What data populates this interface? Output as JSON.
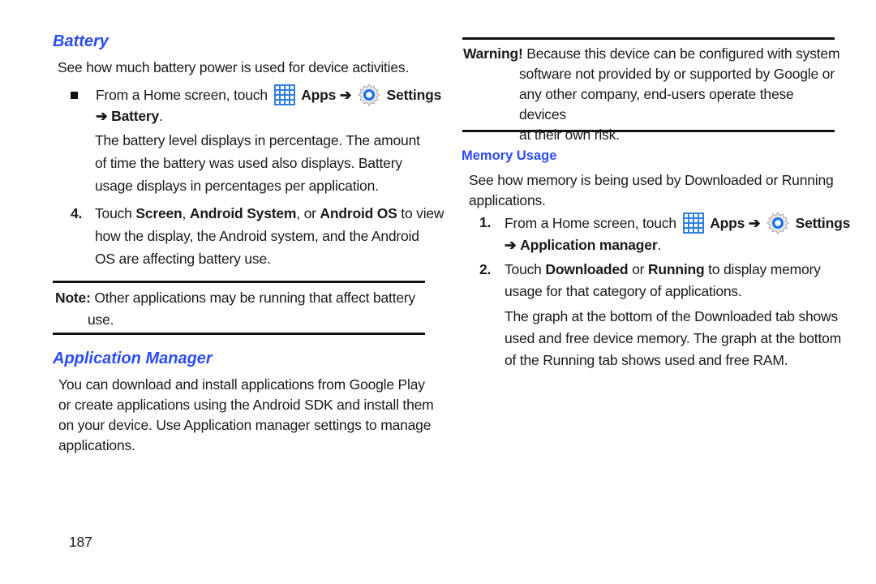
{
  "left": {
    "battery": {
      "heading": "Battery",
      "intro": "See how much battery power is used for device activities.",
      "step_bullet": {
        "prefix": "From a Home screen, touch",
        "apps": "Apps",
        "arrow": "➔",
        "settings": "Settings",
        "line2_arrow": "➔",
        "line2_target": "Battery",
        "line2_end": "."
      },
      "para_lines": [
        "The battery level displays in percentage. The amount",
        "of time the battery was used also displays. Battery",
        "usage displays in percentages per application."
      ],
      "step4": {
        "num": "4.",
        "t1": "Touch ",
        "b1": "Screen",
        "t2": ", ",
        "b2": "Android System",
        "t3": ", or ",
        "b3": "Android OS",
        "t4": " to view",
        "line2": "how the display, the Android system, and the Android",
        "line3": "OS are affecting battery use."
      },
      "note": {
        "label": "Note:",
        "line1": " Other applications may be running that affect battery",
        "line2": "use."
      }
    },
    "app_manager": {
      "heading": "Application Manager",
      "lines": [
        "You can download and install applications from Google Play",
        "or create applications using the Android SDK and install them",
        "on your device. Use Application manager settings to manage",
        "applications."
      ]
    },
    "page_number": "187"
  },
  "right": {
    "warning": {
      "label": "Warning!",
      "line1": " Because this device can be configured with system",
      "line2": "software not provided by or supported by Google or",
      "line3": "any other company, end-users operate these devices",
      "line4": "at their own risk."
    },
    "memory": {
      "heading": "Memory Usage",
      "intro_lines": [
        "See how memory is being used by Downloaded or Running",
        "applications."
      ],
      "step1": {
        "num": "1.",
        "prefix": "From a Home screen, touch",
        "apps": "Apps",
        "arrow": "➔",
        "settings": "Settings",
        "line2_arrow": "➔",
        "line2_target": "Application manager",
        "line2_end": "."
      },
      "step2": {
        "num": "2.",
        "t1": "Touch ",
        "b1": "Downloaded",
        "t2": " or ",
        "b2": "Running",
        "t3": " to display memory",
        "line2": "usage for that category of applications."
      },
      "para_lines": [
        "The graph at the bottom of the Downloaded tab shows",
        "used and free device memory. The graph at the bottom",
        "of the Running tab shows used and free RAM."
      ]
    }
  },
  "colors": {
    "heading_blue": "#2b4df0",
    "apps_icon_blue": "#2f7fe0",
    "rule": "#111111"
  }
}
